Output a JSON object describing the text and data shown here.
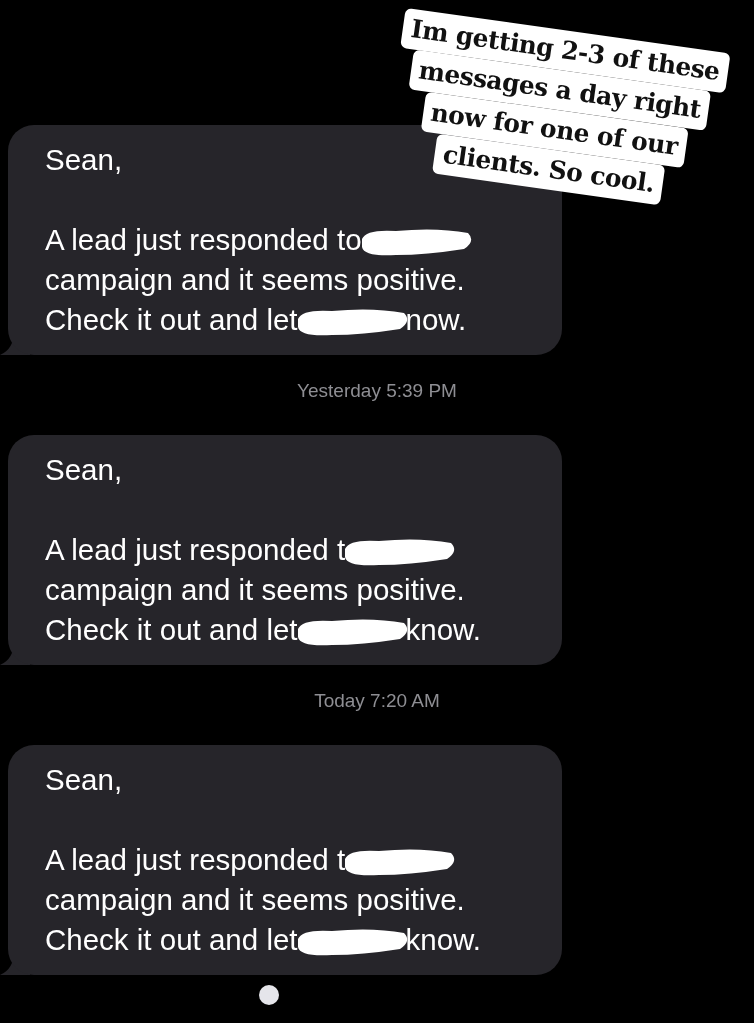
{
  "caption": {
    "lines": [
      "Im getting 2-3 of these",
      "messages a day right",
      "now for one of our",
      "clients. So cool."
    ]
  },
  "messages": [
    {
      "greeting": "Sean,",
      "lines": [
        [
          {
            "kind": "text",
            "text": "A lead just responded to"
          },
          {
            "kind": "redaction"
          }
        ],
        [
          {
            "kind": "text",
            "text": "campaign and it seems positive."
          }
        ],
        [
          {
            "kind": "text",
            "text": "Check it out and let"
          },
          {
            "kind": "redaction"
          },
          {
            "kind": "text",
            "text": "now."
          }
        ]
      ]
    },
    {
      "timestamp": {
        "day": "Yesterday",
        "time": "5:39 PM"
      },
      "greeting": "Sean,",
      "lines": [
        [
          {
            "kind": "text",
            "text": "A lead just responded t"
          },
          {
            "kind": "redaction"
          }
        ],
        [
          {
            "kind": "text",
            "text": "campaign and it seems positive."
          }
        ],
        [
          {
            "kind": "text",
            "text": "Check it out and let"
          },
          {
            "kind": "redaction"
          },
          {
            "kind": "text",
            "text": "know."
          }
        ]
      ]
    },
    {
      "timestamp": {
        "day": "Today",
        "time": "7:20 AM"
      },
      "greeting": "Sean,",
      "lines": [
        [
          {
            "kind": "text",
            "text": "A lead just responded t"
          },
          {
            "kind": "redaction"
          }
        ],
        [
          {
            "kind": "text",
            "text": "campaign and it seems positive."
          }
        ],
        [
          {
            "kind": "text",
            "text": "Check it out and let"
          },
          {
            "kind": "redaction"
          },
          {
            "kind": "text",
            "text": "know."
          }
        ]
      ]
    }
  ]
}
